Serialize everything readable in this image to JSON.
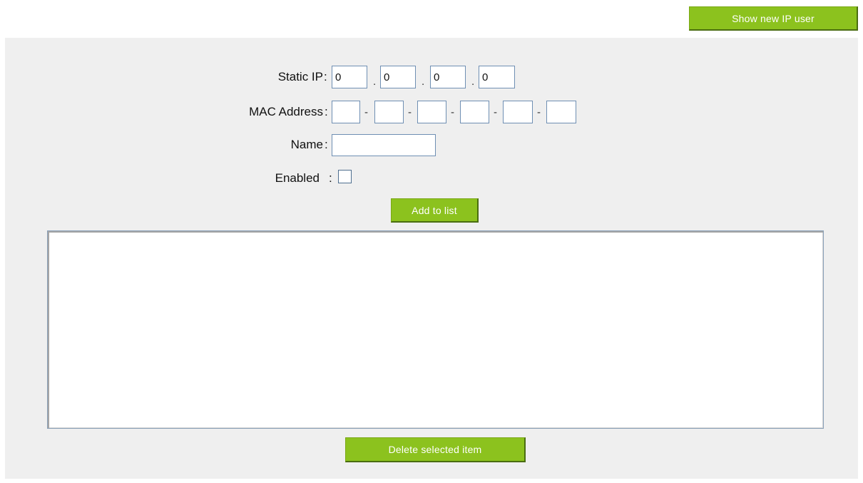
{
  "header": {
    "show_new_ip_user_label": "Show new IP user"
  },
  "form": {
    "static_ip": {
      "label": "Static IP",
      "colon": ":",
      "octets": [
        "0",
        "0",
        "0",
        "0"
      ],
      "separator": "."
    },
    "mac_address": {
      "label": "MAC Address",
      "colon": ":",
      "parts": [
        "",
        "",
        "",
        "",
        "",
        ""
      ],
      "separator": "-"
    },
    "name": {
      "label": "Name",
      "colon": ":",
      "value": ""
    },
    "enabled": {
      "label": "Enabled",
      "colon": ":",
      "checked": false
    },
    "add_to_list_label": "Add to list"
  },
  "list": {
    "items": []
  },
  "footer": {
    "delete_selected_label": "Delete selected item"
  },
  "colors": {
    "button_green": "#8cc21e",
    "panel_gray": "#efefef",
    "input_border": "#6f8fb3"
  }
}
